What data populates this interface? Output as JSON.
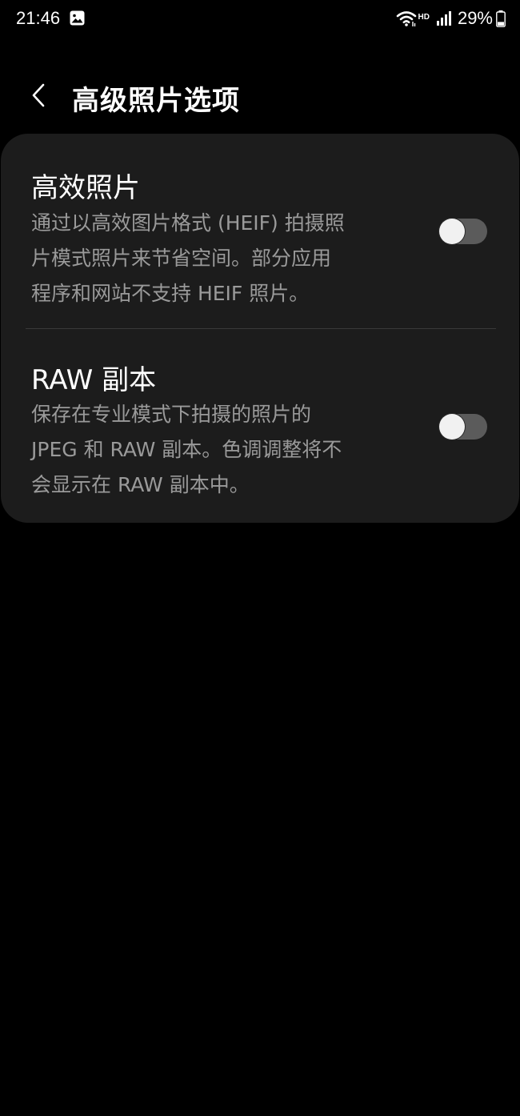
{
  "status_bar": {
    "time": "21:46",
    "gallery_icon": "image-icon",
    "network_badge": "HD",
    "battery_percent": "29%",
    "battery_level": 0.29
  },
  "header": {
    "back_icon": "chevron-left-icon",
    "title": "高级照片选项"
  },
  "settings": [
    {
      "title": "高效照片",
      "description_lines": [
        "通过以高效图片格式 (HEIF) 拍摄照",
        "片模式照片来节省空间。部分应用",
        "程序和网站不支持 HEIF 照片。"
      ],
      "enabled": false
    },
    {
      "title": "RAW 副本",
      "description_lines": [
        "保存在专业模式下拍摄的照片的",
        "JPEG 和 RAW 副本。色调调整将不",
        "会显示在 RAW 副本中。"
      ],
      "enabled": false
    }
  ],
  "colors": {
    "background": "#000000",
    "card": "#1c1c1c",
    "secondary_text": "#9a9a9a",
    "toggle_off_track": "#5b5b5b",
    "toggle_knob": "#f1f1f1"
  }
}
